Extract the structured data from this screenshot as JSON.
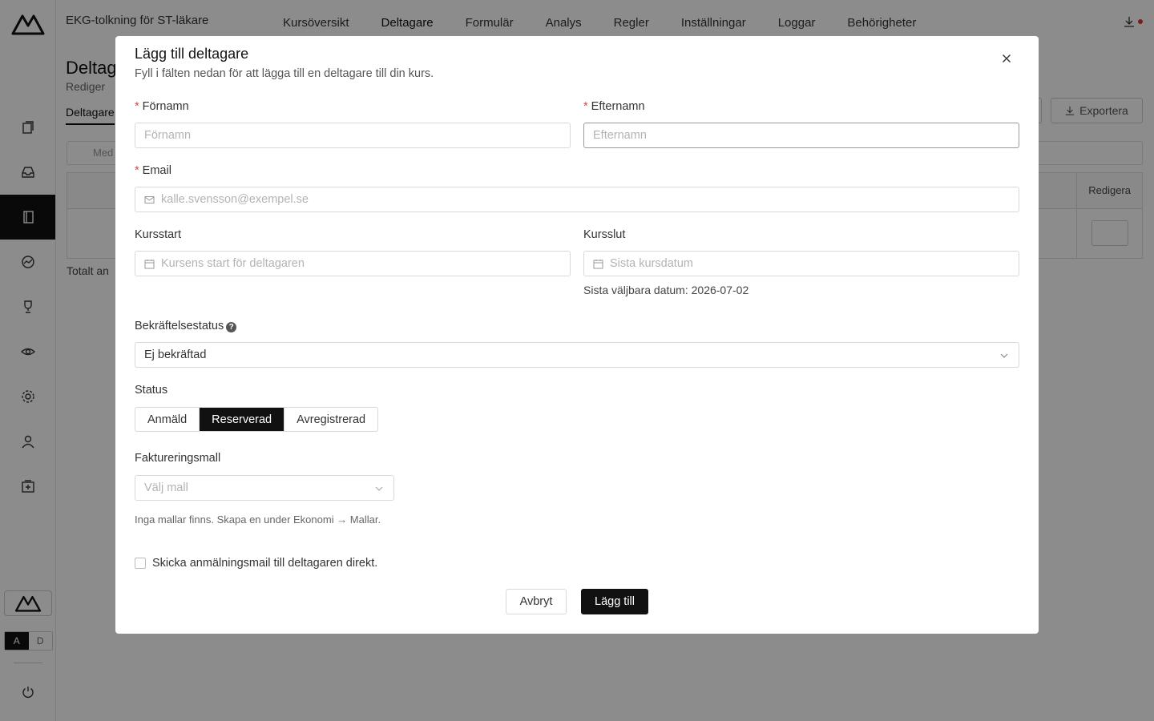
{
  "app": {
    "course_title": "EKG-tolkning för ST-läkare",
    "nav": [
      "Kursöversikt",
      "Deltagare",
      "Formulär",
      "Analys",
      "Regler",
      "Inställningar",
      "Loggar",
      "Behörigheter"
    ],
    "page_heading": "Deltag",
    "page_sub": "Rediger",
    "page_tab": "Deltagare",
    "export_label": "Exportera",
    "search_placeholder": "Med",
    "table_edit_header": "Redigera",
    "total_text": "Totalt an",
    "lang": {
      "a": "A",
      "d": "D"
    }
  },
  "modal": {
    "title": "Lägg till deltagare",
    "description": "Fyll i fälten nedan för att lägga till en deltagare till din kurs.",
    "required_mark": "*",
    "first_name": {
      "label": "Förnamn",
      "placeholder": "Förnamn"
    },
    "last_name": {
      "label": "Efternamn",
      "placeholder": "Efternamn"
    },
    "email": {
      "label": "Email",
      "placeholder": "kalle.svensson@exempel.se"
    },
    "course_start": {
      "label": "Kursstart",
      "placeholder": "Kursens start för deltagaren"
    },
    "course_end": {
      "label": "Kursslut",
      "placeholder": "Sista kursdatum",
      "hint": "Sista väljbara datum: 2026-07-02"
    },
    "confirmation_status": {
      "label": "Bekräftelsestatus",
      "help": "?",
      "value": "Ej bekräftad"
    },
    "status": {
      "label": "Status",
      "options": [
        "Anmäld",
        "Reserverad",
        "Avregistrerad"
      ],
      "selected": "Reserverad"
    },
    "billing_template": {
      "label": "Faktureringsmall",
      "placeholder": "Välj mall",
      "hint": "Inga mallar finns. Skapa en under Ekonomi → Mallar."
    },
    "send_mail_label": "Skicka anmälningsmail till deltagaren direkt.",
    "cancel_label": "Avbryt",
    "submit_label": "Lägg till"
  }
}
